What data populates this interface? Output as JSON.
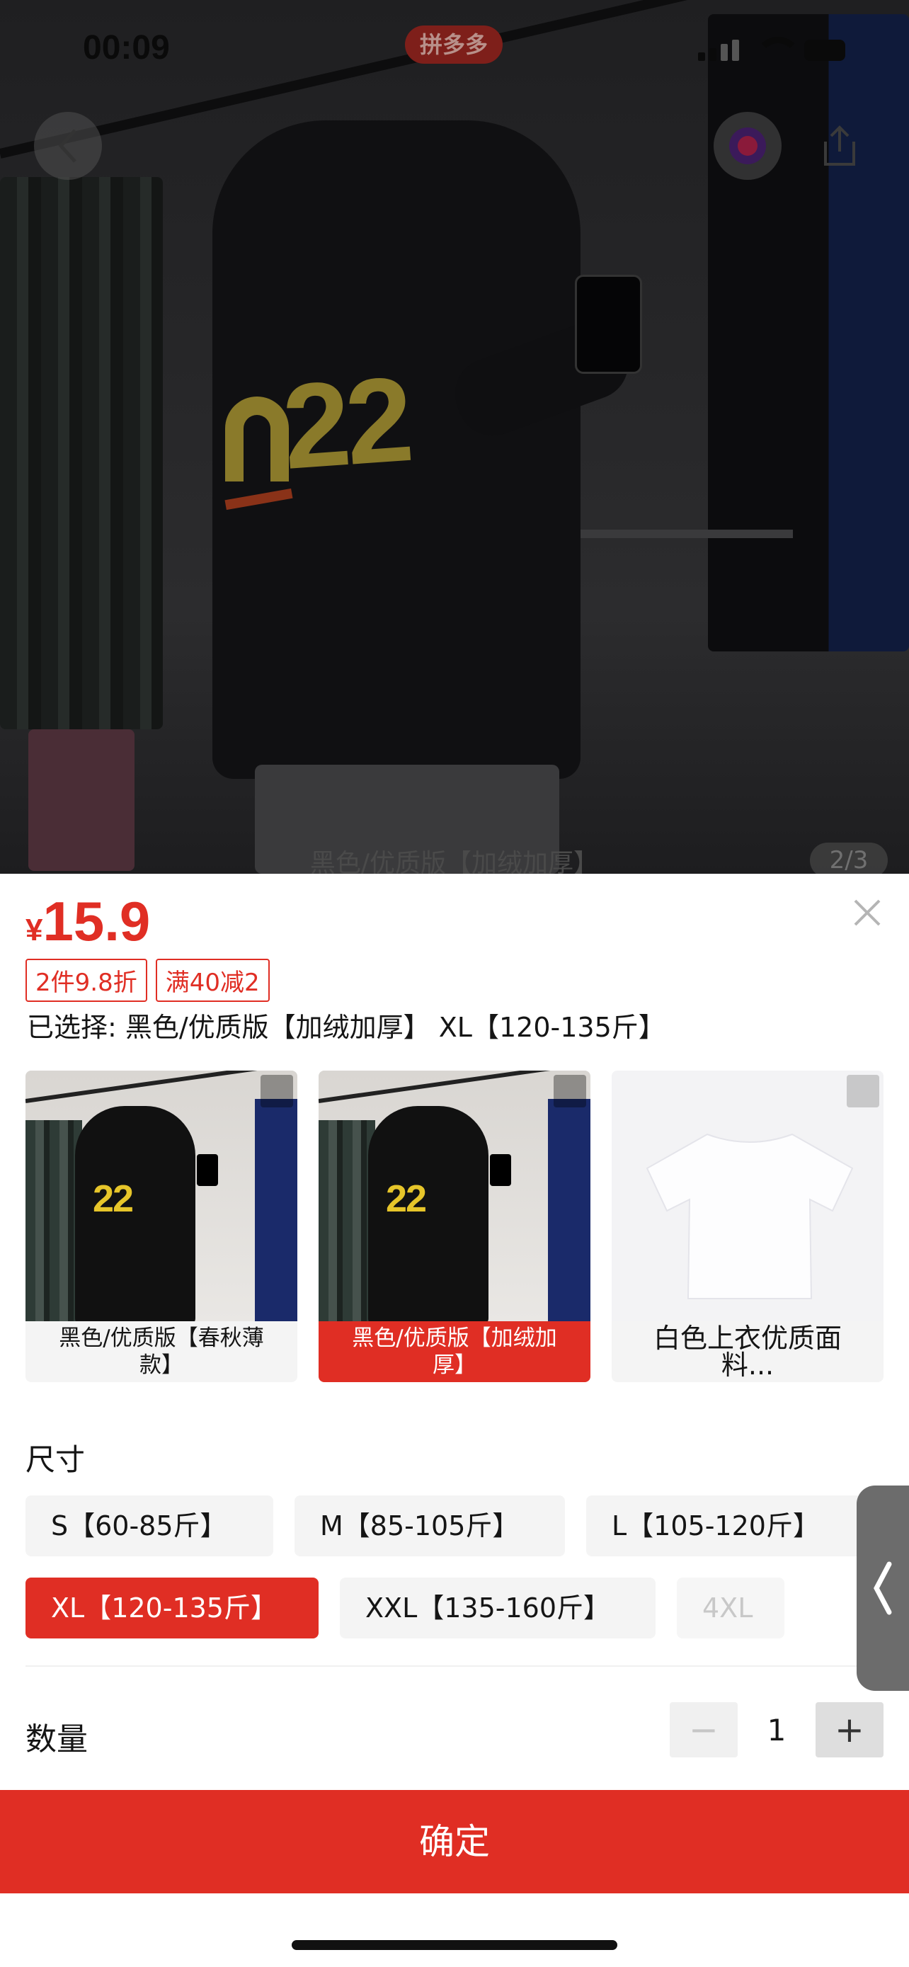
{
  "status_bar": {
    "time": "00:09",
    "app_badge": "拼多多"
  },
  "photo": {
    "caption": "黑色/优质版【加绒加厚】",
    "counter": "2/3"
  },
  "price": {
    "currency": "¥",
    "value": "15.9",
    "color": "#e02e24"
  },
  "promo_tags": [
    "2件9.8折",
    "满40减2"
  ],
  "selected_text": "已选择: 黑色/优质版【加绒加厚】 XL【120-135斤】",
  "color_options": [
    {
      "label": "黑色/优质版【春秋薄款】",
      "active": false
    },
    {
      "label": "黑色/优质版【加绒加厚】",
      "active": true
    },
    {
      "label": "白色上衣优质面料...",
      "active": false
    }
  ],
  "size_section": {
    "title": "尺寸",
    "options": [
      {
        "label": "S【60-85斤】",
        "state": "normal"
      },
      {
        "label": "M【85-105斤】",
        "state": "normal"
      },
      {
        "label": "L【105-120斤】",
        "state": "normal"
      },
      {
        "label": "XL【120-135斤】",
        "state": "active"
      },
      {
        "label": "XXL【135-160斤】",
        "state": "normal"
      },
      {
        "label": "4XL",
        "state": "disabled"
      }
    ]
  },
  "quantity": {
    "label": "数量",
    "value": "1",
    "minus": "−",
    "plus": "+"
  },
  "confirm_label": "确定",
  "icons": {
    "back": "chevron-left-icon",
    "avatar": "avatar",
    "share": "share-icon",
    "close": "close-icon",
    "expand": "expand-icon",
    "side_tab": "chevron-left-icon"
  }
}
